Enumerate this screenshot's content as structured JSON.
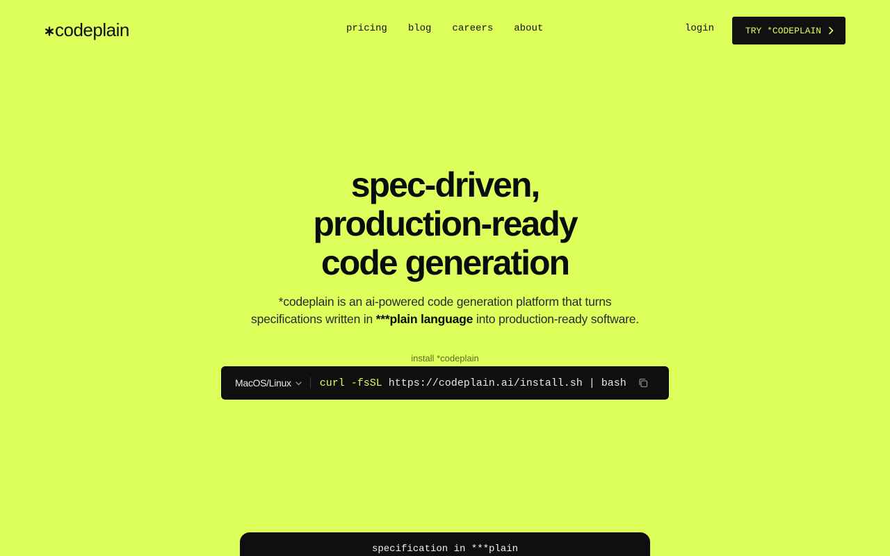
{
  "brand": {
    "logo_text": "codeplain",
    "accent": "#ddff5c",
    "dark": "#111111"
  },
  "nav": {
    "items": [
      {
        "label": "pricing"
      },
      {
        "label": "blog"
      },
      {
        "label": "careers"
      },
      {
        "label": "about"
      }
    ],
    "login_label": "login",
    "cta_label": "TRY *CODEPLAIN"
  },
  "hero": {
    "title_lines": [
      "spec-driven,",
      "production-ready",
      "code generation"
    ],
    "subtitle_part1": "*codeplain is an ai-powered code generation platform that turns",
    "subtitle_part2": "specifications written in ",
    "subtitle_bold": "***plain language",
    "subtitle_part3": " into production-ready software."
  },
  "install": {
    "label": "install *codeplain",
    "os_selected": "MacOS/Linux",
    "command_keyword": "curl -fsSL",
    "command_rest": " https://codeplain.ai/install.sh | bash"
  },
  "spec_panel": {
    "title": "specification in ***plain"
  }
}
